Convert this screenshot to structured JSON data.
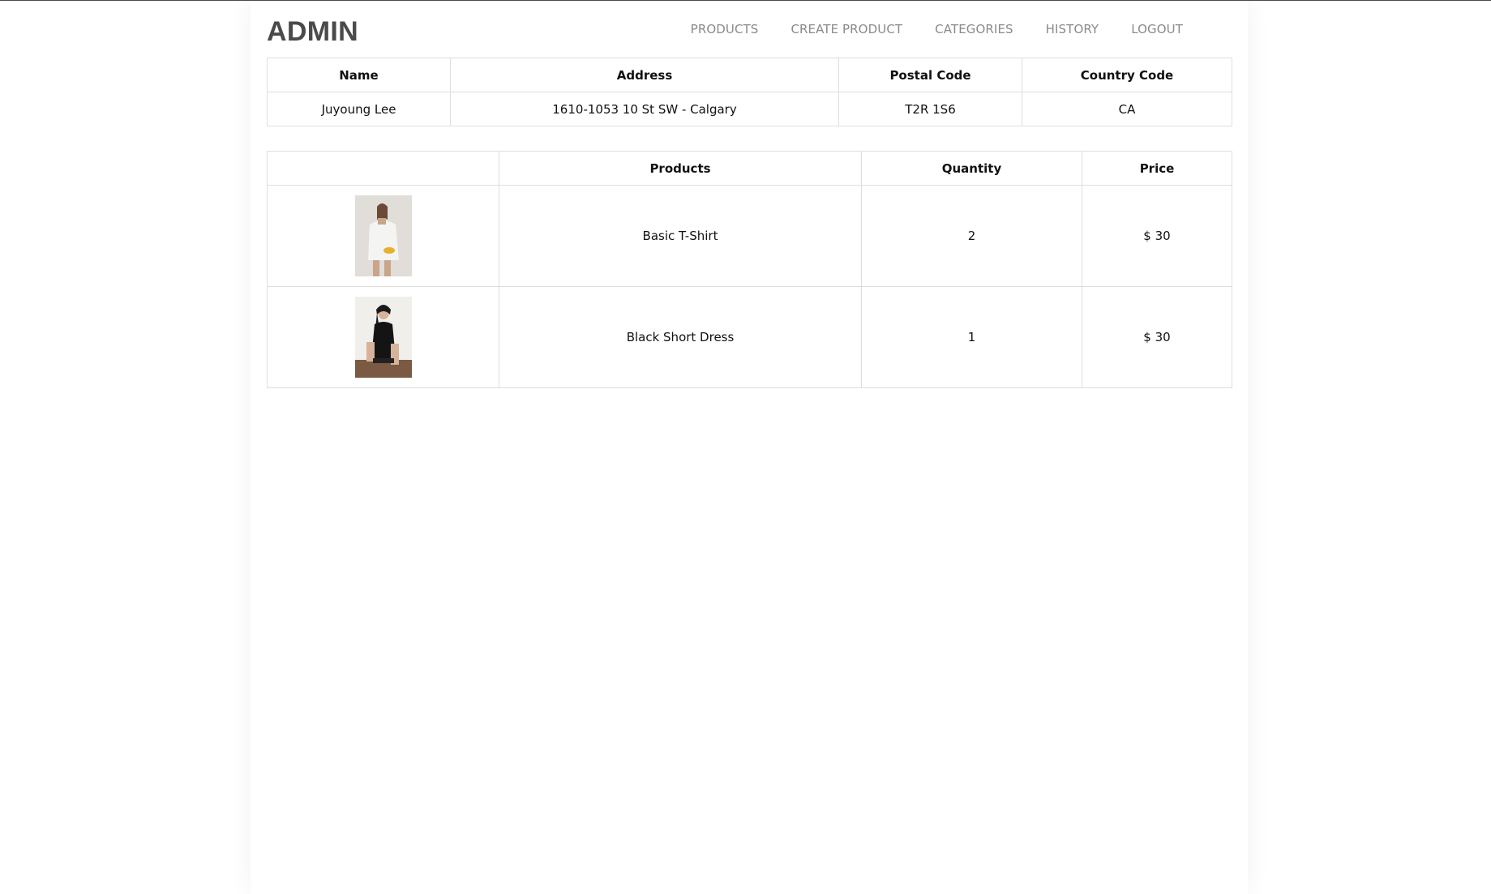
{
  "header": {
    "logo": "ADMIN",
    "nav": [
      {
        "label": "PRODUCTS"
      },
      {
        "label": "CREATE PRODUCT"
      },
      {
        "label": "CATEGORIES"
      },
      {
        "label": "HISTORY"
      },
      {
        "label": "LOGOUT"
      }
    ]
  },
  "customer": {
    "headers": [
      "Name",
      "Address",
      "Postal Code",
      "Country Code"
    ],
    "row": {
      "name": "Juyoung Lee",
      "address": "1610-1053 10 St SW - Calgary",
      "postal_code": "T2R 1S6",
      "country_code": "CA"
    }
  },
  "order": {
    "headers": [
      "",
      "Products",
      "Quantity",
      "Price"
    ],
    "items": [
      {
        "image_icon": "product-photo-white-tshirt",
        "product": "Basic T-Shirt",
        "quantity": "2",
        "price": "$ 30"
      },
      {
        "image_icon": "product-photo-black-dress",
        "product": "Black Short Dress",
        "quantity": "1",
        "price": "$ 30"
      }
    ]
  },
  "colors": {
    "logo": "#4a4a4a",
    "nav_text": "#8a8a8a",
    "table_border": "#dedede",
    "text": "#111111"
  }
}
